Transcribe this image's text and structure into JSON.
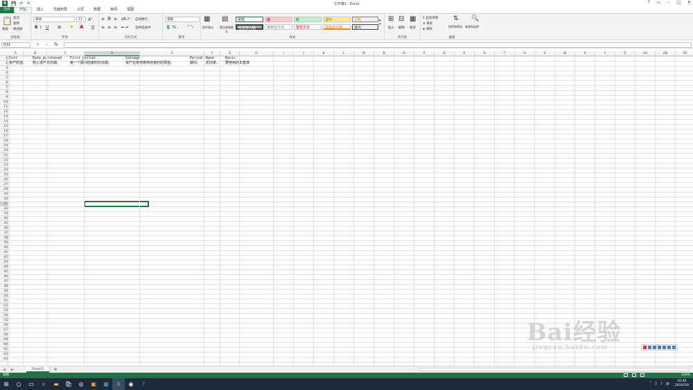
{
  "window": {
    "title": "工作簿1 - Excel"
  },
  "quick_access": {
    "save": "💾",
    "undo": "↶",
    "redo": "↷"
  },
  "tabs": [
    "开始",
    "插入",
    "页面布局",
    "公式",
    "数据",
    "审阅",
    "视图"
  ],
  "file_tab": "文件",
  "ribbon": {
    "clipboard": {
      "paste": "粘贴",
      "cut": "剪切",
      "copy": "复制",
      "format_painter": "格式刷",
      "label": "剪贴板"
    },
    "font": {
      "name": "宋体",
      "size": "11",
      "bold": "B",
      "italic": "I",
      "underline": "U",
      "label": "字体"
    },
    "alignment": {
      "wrap": "自动换行",
      "merge": "合并后居中",
      "label": "对齐方式"
    },
    "number": {
      "format": "常规",
      "label": "数字"
    },
    "styles": {
      "conditional": "条件格式",
      "table": "套用表格格式",
      "cells": [
        "常规",
        "差",
        "好",
        "适中",
        "计算",
        "检查单元格",
        "解释性文本",
        "警告文本",
        "链接单元格",
        "输出"
      ],
      "label": "样式"
    },
    "cells": {
      "insert": "插入",
      "delete": "删除",
      "format": "格式",
      "label": "单元格"
    },
    "editing": {
      "autosum": "自动求和",
      "fill": "填充",
      "clear": "清除",
      "sort": "排序和筛选",
      "find": "查找和选择",
      "label": "编辑"
    }
  },
  "formula_bar": {
    "namebox": "D31",
    "cancel": "✕",
    "enter": "✓",
    "fx": "fx",
    "value": ""
  },
  "columns": [
    "A",
    "B",
    "C",
    "D",
    "E",
    "F",
    "G",
    "H",
    "I",
    "J",
    "K",
    "L",
    "M",
    "N",
    "O",
    "P",
    "Q",
    "R",
    "S",
    "T",
    "U",
    "V",
    "W",
    "X",
    "Y",
    "Z",
    "AA",
    "AB",
    "AC"
  ],
  "rows": [
    "1",
    "2",
    "3",
    "4",
    "5",
    "6",
    "7",
    "8",
    "9",
    "10",
    "11",
    "12",
    "13",
    "14",
    "15",
    "16",
    "17",
    "18",
    "19",
    "20",
    "21",
    "22",
    "23",
    "24",
    "25",
    "26",
    "27",
    "28",
    "29",
    "30",
    "31",
    "32",
    "33",
    "34",
    "35",
    "36",
    "37",
    "38",
    "39",
    "40",
    "41",
    "42",
    "43",
    "44",
    "45",
    "46",
    "47",
    "48",
    "49",
    "50",
    "51",
    "52",
    "53",
    "54",
    "55",
    "56",
    "57",
    "58",
    "59",
    "60",
    "61",
    "62",
    "63"
  ],
  "cells": {
    "row1": [
      "Cost",
      "Date_purchased",
      "First_period",
      "Salvage",
      "Period",
      "Rate",
      "Basis"
    ],
    "row2": [
      "资产原值。",
      "购入资产的日期。",
      "第一个期间结束时的日期。",
      "资产在使用寿命结束时的残值。",
      "期间。",
      "折旧率。",
      "要使用的年基准"
    ]
  },
  "sheet_tab": "Sheet1",
  "add_sheet": "⊕",
  "status": {
    "mode": "就绪",
    "zoom": "100%"
  },
  "taskbar": {
    "time": "10:40",
    "date": "2016/2/8"
  },
  "watermark": {
    "brand": "Bai经验",
    "url": "jingyan.baidu.com"
  }
}
